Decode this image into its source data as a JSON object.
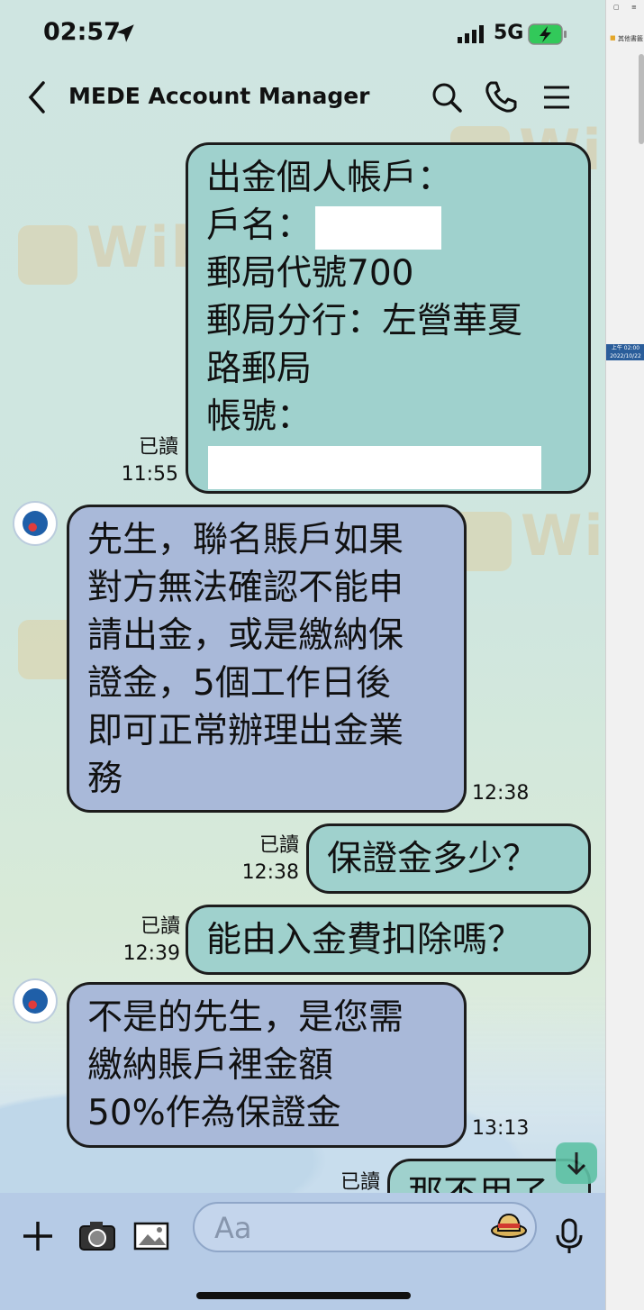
{
  "status": {
    "time": "02:57",
    "network": "5G"
  },
  "header": {
    "title": "MEDE Account Manager"
  },
  "messages": [
    {
      "side": "out",
      "lines": [
        "出金個人帳戶：",
        "戶名：",
        "郵局代號700",
        "郵局分行：左營華夏",
        "路郵局",
        "帳號："
      ],
      "read": "已讀",
      "time": "11:55"
    },
    {
      "side": "in",
      "lines": [
        "先生，聯名賬戶如果",
        "對方無法確認不能申",
        "請出金，或是繳納保",
        "證金，5個工作日後",
        "即可正常辦理出金業",
        "務"
      ],
      "time": "12:38"
    },
    {
      "side": "out",
      "lines": [
        "保證金多少？"
      ],
      "read": "已讀",
      "time": "12:38"
    },
    {
      "side": "out",
      "lines": [
        "能由入金費扣除嗎？"
      ],
      "read": "已讀",
      "time": "12:39"
    },
    {
      "side": "in",
      "lines": [
        "不是的先生，是您需",
        "繳納賬戶裡金額",
        "50%作為保證金"
      ],
      "time": "13:13"
    },
    {
      "side": "out",
      "lines": [
        "那不用了"
      ],
      "read": "已讀"
    }
  ],
  "input": {
    "placeholder": "Aa"
  },
  "watermark": "WikiFX",
  "side_panel": {
    "item1": "其他書籤",
    "date_line1": "上午 02:00",
    "date_line2": "2022/10/22"
  },
  "colors": {
    "outgoing": "#9fd1cd",
    "incoming": "#a9b9d9",
    "inputbar": "#b6cbe6"
  }
}
